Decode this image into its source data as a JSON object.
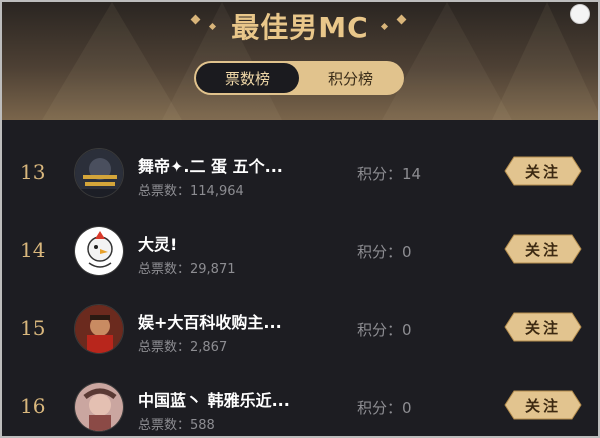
{
  "header": {
    "title": "最佳男MC",
    "tabs": [
      {
        "label": "票数榜",
        "active": true
      },
      {
        "label": "积分榜",
        "active": false
      }
    ]
  },
  "entries": [
    {
      "rank": "13",
      "name": "舞帝✦.二 蛋 五个...",
      "votes": "总票数：114,964",
      "score": "积分：14",
      "follow": "关注"
    },
    {
      "rank": "14",
      "name": "大灵!",
      "votes": "总票数：29,871",
      "score": "积分：0",
      "follow": "关注"
    },
    {
      "rank": "15",
      "name": "娱+大百科收购主...",
      "votes": "总票数：2,867",
      "score": "积分：0",
      "follow": "关注"
    },
    {
      "rank": "16",
      "name": "中国蓝丶 韩雅乐近...",
      "votes": "总票数：588",
      "score": "积分：0",
      "follow": "关注"
    }
  ],
  "colors": {
    "accent_gold": "#e1c38d",
    "background": "#1d1d22",
    "muted_text": "#8d8d92"
  }
}
